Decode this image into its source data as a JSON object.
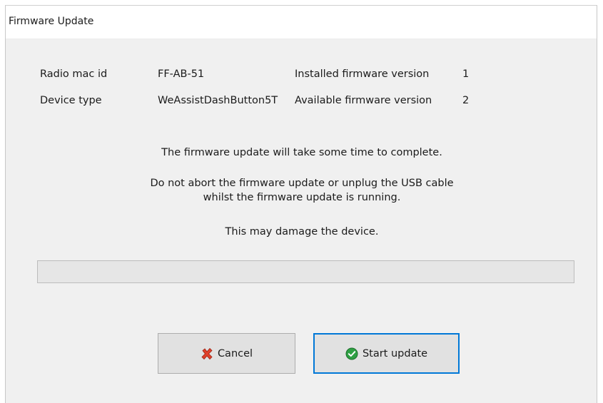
{
  "window": {
    "title": "Firmware Update"
  },
  "device_info": {
    "radio_mac_label": "Radio mac id",
    "radio_mac_value": "FF-AB-51",
    "device_type_label": "Device type",
    "device_type_value": "WeAssistDashButton5T",
    "installed_label": "Installed firmware version",
    "installed_value": "1",
    "available_label": "Available firmware version",
    "available_value": "2"
  },
  "messages": {
    "line1": "The firmware update will take some time to complete.",
    "line2a": "Do not abort the firmware update or unplug the USB cable",
    "line2b": "whilst the firmware update is running.",
    "line3": "This may damage the device."
  },
  "progress": {
    "fraction": 0
  },
  "buttons": {
    "cancel_label": "Cancel",
    "cancel_icon": "red-x-icon",
    "start_label": "Start update",
    "start_icon": "green-check-icon"
  },
  "colors": {
    "accent_border": "#0078d7",
    "cancel_icon": "#e0402a",
    "start_icon": "#2ea043"
  }
}
